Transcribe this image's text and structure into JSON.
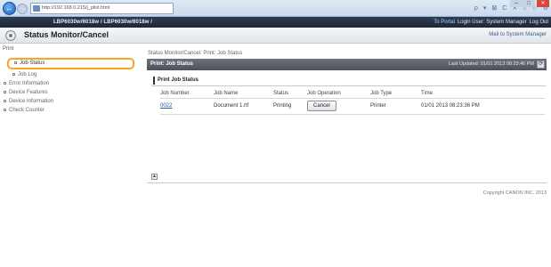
{
  "browser": {
    "address": "http://192.168.0.215/j_plist.html",
    "tools": [
      "ρ",
      "▾",
      "⊠",
      "C",
      "✕",
      "⌂",
      "☆",
      "⚙"
    ]
  },
  "window": {
    "minimize": "–",
    "maximize": "□",
    "close": "✕"
  },
  "header": {
    "model": "LBP6030w/6018w / LBP6030w/6018w /",
    "links": {
      "portal": "To Portal",
      "login": "Login User: System Manager",
      "logout": "Log Out"
    }
  },
  "title_bar": {
    "heading": "Status Monitor/Cancel",
    "mail_link": "Mail to System Manager"
  },
  "sidebar": {
    "section": "Print",
    "items": [
      {
        "label": "Job Status",
        "active": true
      },
      {
        "label": "Job Log"
      },
      {
        "label": "Error Information"
      },
      {
        "label": "Device Features"
      },
      {
        "label": "Device Information"
      },
      {
        "label": "Check Counter"
      }
    ]
  },
  "main": {
    "breadcrumb": "Status Monitor/Cancel: Print: Job Status",
    "section_title": "Print: Job Status",
    "last_updated": "Last Updated: 01/01 2013 08:23:46 PM",
    "panel_title": "Print Job Status",
    "table": {
      "headers": [
        "Job Number",
        "Job Name",
        "Status",
        "Job Operation",
        "Job Type",
        "Time"
      ],
      "rows": [
        {
          "number": "0022",
          "name": "Document 1.rtf",
          "status": "Printing",
          "operation": "Cancel",
          "type": "Printer",
          "time": "01/01 2013 08:23:36 PM"
        }
      ]
    },
    "copyright": "Copyright CANON INC. 2013"
  },
  "colors": {
    "accent": "#f5a623",
    "header_bg": "#1d2838",
    "section_bar": "#4b5158",
    "link": "#2458a8"
  }
}
